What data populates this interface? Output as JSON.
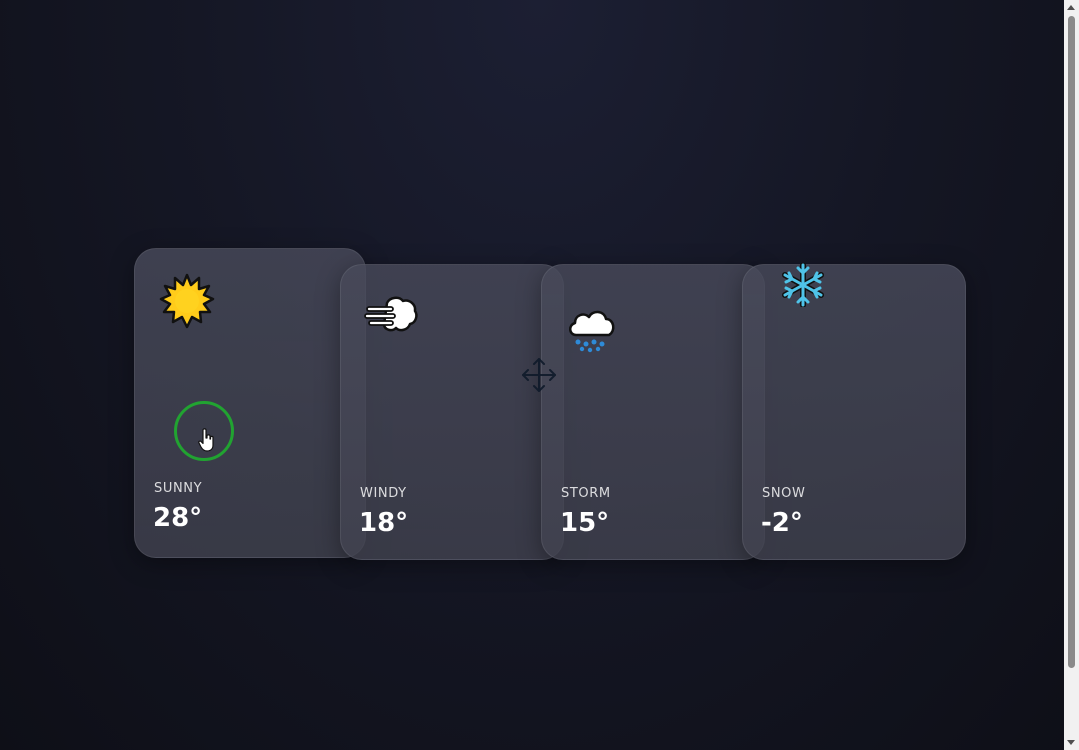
{
  "cards": [
    {
      "id": "sunny",
      "label": "SUNNY",
      "temp": "28°",
      "icon": "sun-icon"
    },
    {
      "id": "windy",
      "label": "WINDY",
      "temp": "18°",
      "icon": "wind-icon"
    },
    {
      "id": "storm",
      "label": "STORM",
      "temp": "15°",
      "icon": "rain-cloud-icon"
    },
    {
      "id": "snow",
      "label": "SNOW",
      "temp": "-2°",
      "icon": "snowflake-icon"
    }
  ],
  "colors": {
    "cursor_ring": "#21a331",
    "sun": "#ffcc1a",
    "snowflake": "#4fc3e8",
    "rain": "#2e8bd8"
  }
}
